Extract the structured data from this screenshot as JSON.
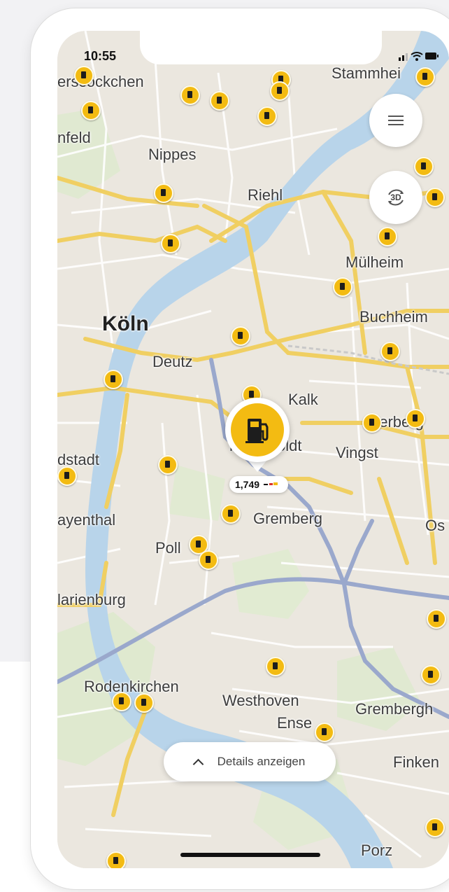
{
  "status_bar": {
    "time": "10:55"
  },
  "map": {
    "places": {
      "stammheim": "Stammhei",
      "merkenich": "ersɞockchen",
      "feld": "nfeld",
      "nippes": "Nippes",
      "riehl": "Riehl",
      "muelheim": "Mülheim",
      "buchheim": "Buchheim",
      "koeln": "Köln",
      "deutz": "Deutz",
      "kalk": "Kalk",
      "humboldt": "oldt",
      "humboldt_prefix": "r",
      "vingst": "Vingst",
      "neubrueck": "herberg",
      "altstadt": "dstadt",
      "gremberg": "Gremberg",
      "bayenthal": "ayenthal",
      "ostheim": "Os",
      "poll": "Poll",
      "marienburg": "larienburg",
      "rodenkirchen": "Rodenkirchen",
      "westhoven": "Westhoven",
      "ensen": "Ense",
      "gremberghoven": "Grembergh",
      "finkenberg": "Finken",
      "porz": "Porz"
    },
    "selected_price": "1,749",
    "station_icon": "fuel-pump-icon"
  },
  "controls": {
    "menu_icon": "menu-icon",
    "view_3d_label": "3D"
  },
  "details_button": {
    "label": "Details anzeigen"
  },
  "colors": {
    "accent": "#f3bb12",
    "river": "#b8d4ea",
    "road_major": "#f0cf62",
    "highway": "#9aa8cc"
  }
}
